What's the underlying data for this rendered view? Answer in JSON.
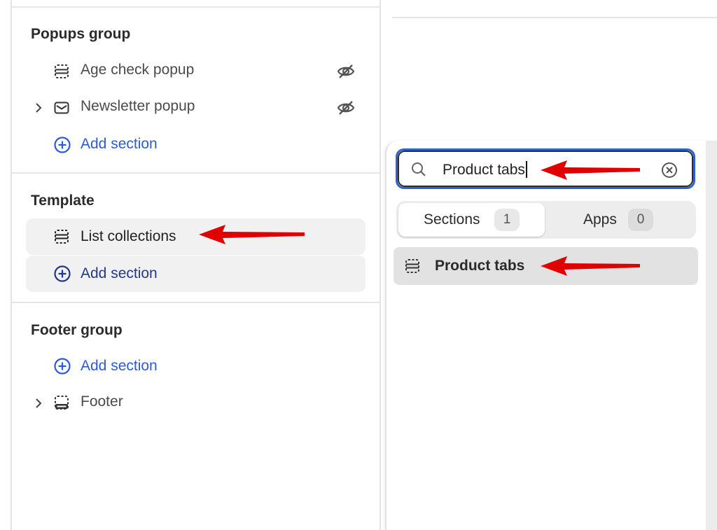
{
  "sidebar": {
    "groups": [
      {
        "title": "Popups group",
        "items": [
          {
            "label": "Age check popup",
            "icon": "section-icon",
            "hidden": true
          },
          {
            "label": "Newsletter popup",
            "icon": "envelope-icon",
            "hidden": true,
            "expandable": true
          }
        ],
        "add_label": "Add section"
      },
      {
        "title": "Template",
        "items": [
          {
            "label": "List collections",
            "icon": "section-icon"
          }
        ],
        "add_label": "Add section"
      },
      {
        "title": "Footer group",
        "add_label": "Add section",
        "items": [
          {
            "label": "Footer",
            "icon": "footer-icon",
            "expandable": true
          }
        ]
      }
    ]
  },
  "add_section_panel": {
    "search": {
      "value": "Product tabs",
      "placeholder": ""
    },
    "tabs": [
      {
        "label": "Sections",
        "count": "1",
        "selected": true
      },
      {
        "label": "Apps",
        "count": "0",
        "selected": false
      }
    ],
    "results": [
      {
        "label": "Product tabs",
        "icon": "section-icon"
      }
    ]
  },
  "colors": {
    "accent_blue": "#2a5bd7",
    "focus_ring": "#2f63c9",
    "annotation_arrow": "#e00000"
  }
}
